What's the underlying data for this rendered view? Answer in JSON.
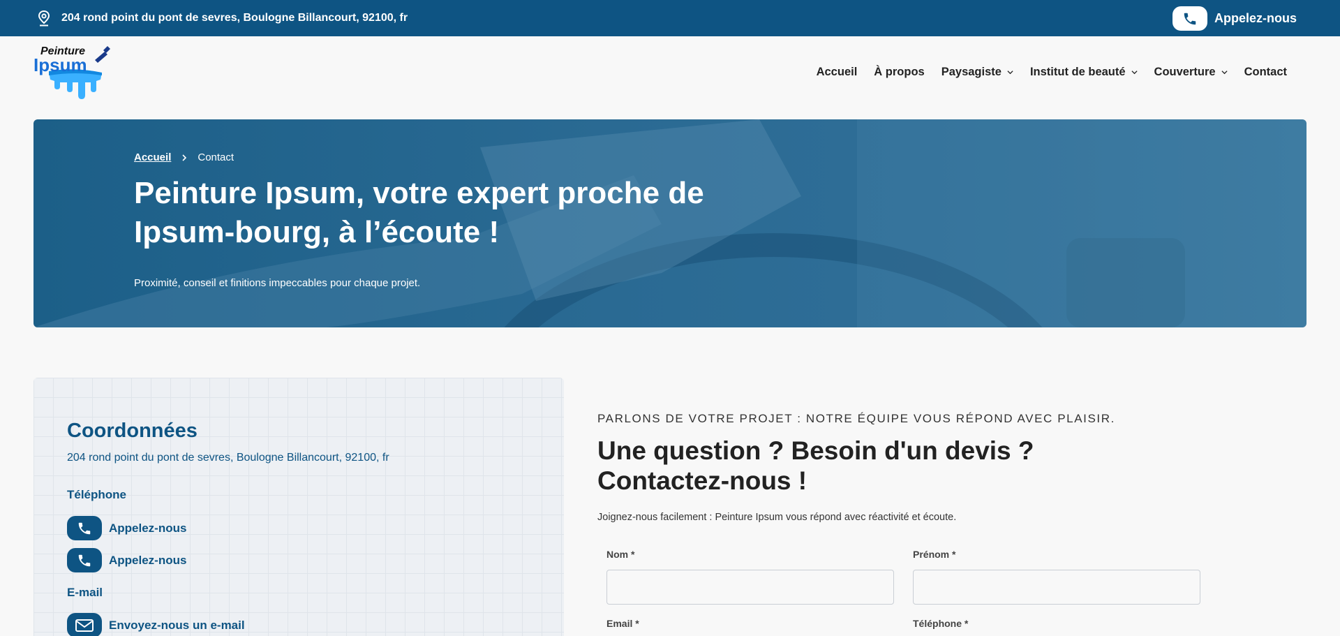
{
  "topbar": {
    "address": "204 rond point du pont de sevres, Boulogne Billancourt, 92100, fr",
    "call_label": "Appelez-nous",
    "address_icon": "map-pin-icon",
    "phone_icon": "phone-icon"
  },
  "logo": {
    "line1": "Peinture",
    "line2": "Ipsum"
  },
  "nav": {
    "items": [
      {
        "label": "Accueil"
      },
      {
        "label": "À propos"
      },
      {
        "label": "Paysagiste"
      },
      {
        "label": "Institut de beauté"
      },
      {
        "label": "Couverture"
      },
      {
        "label": "Contact"
      }
    ]
  },
  "hero": {
    "breadcrumb_home": "Accueil",
    "breadcrumb_current": "Contact",
    "title": "Peinture Ipsum, votre expert proche de Ipsum-bourg, à l’écoute !",
    "subtitle": "Proximité, conseil et finitions impeccables pour chaque projet."
  },
  "coords": {
    "title": "Coordonnées",
    "address": "204 rond point du pont de sevres, Boulogne Billancourt, 92100, fr",
    "phone_heading": "Téléphone",
    "phone1": "Appelez-nous",
    "phone2": "Appelez-nous",
    "email_heading": "E-mail",
    "email": "Envoyez-nous un e-mail"
  },
  "form": {
    "kicker": "PARLONS DE VOTRE PROJET : NOTRE ÉQUIPE VOUS RÉPOND AVEC PLAISIR.",
    "title": "Une question ? Besoin d'un devis ? Contactez-nous !",
    "desc": "Joignez-nous facilement : Peinture Ipsum vous répond avec réactivité et écoute.",
    "nom_label": "Nom *",
    "prenom_label": "Prénom *",
    "email_label": "Email *",
    "tel_label": "Téléphone *",
    "nom_value": "",
    "prenom_value": ""
  },
  "colors": {
    "brand": "#0e5483",
    "background": "#f8f8f8"
  }
}
